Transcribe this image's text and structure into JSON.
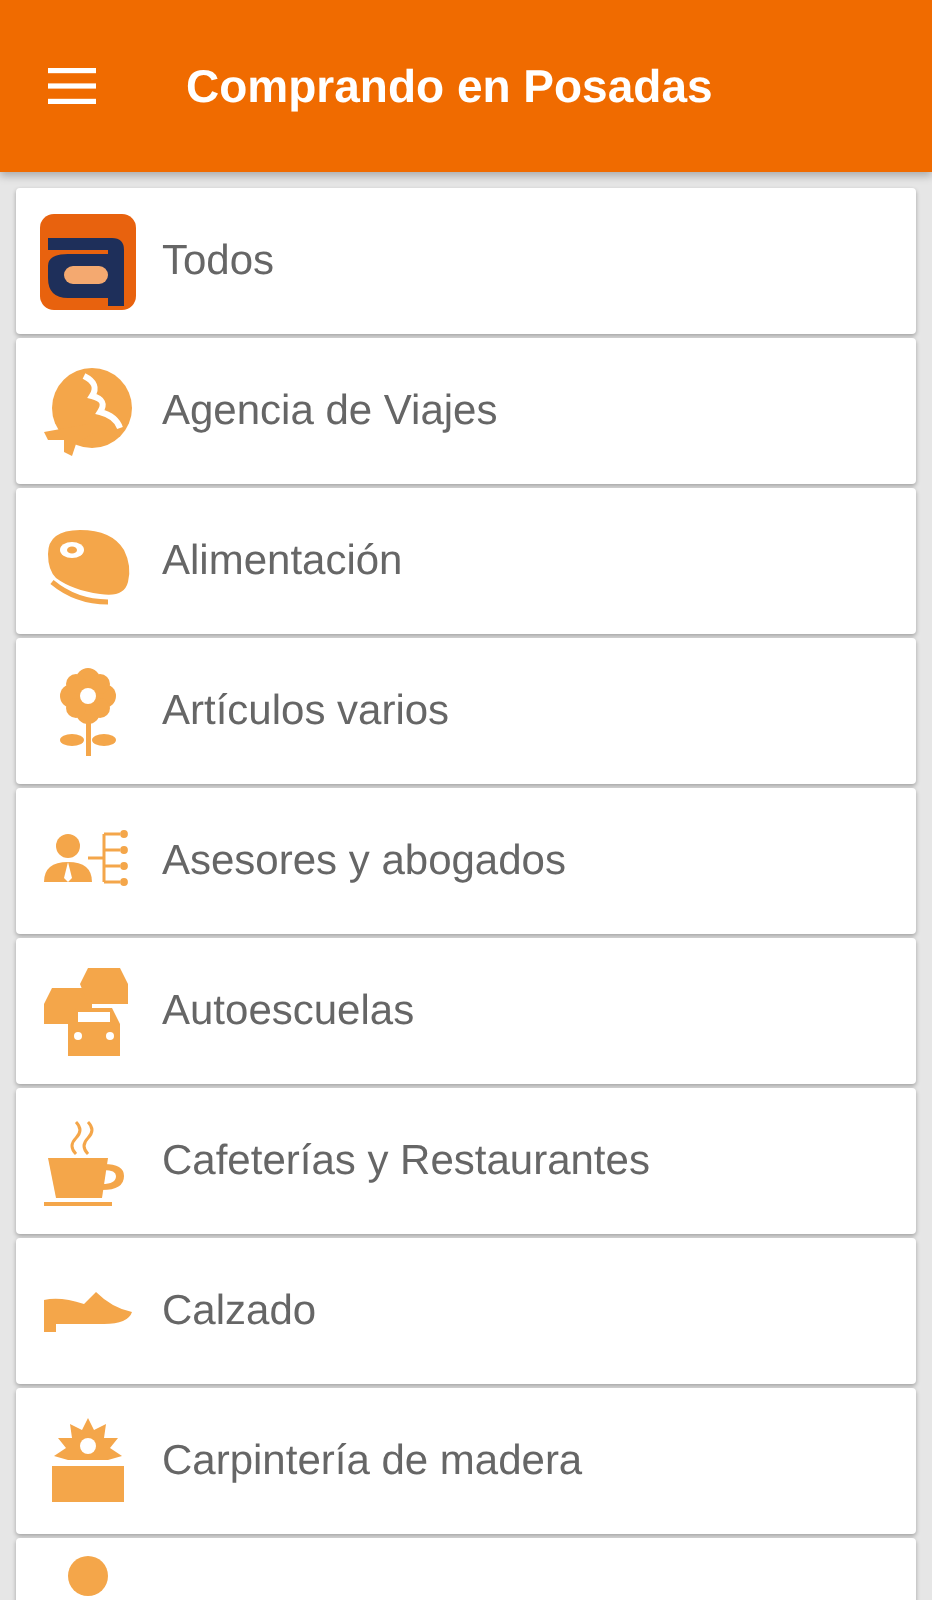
{
  "app_bar": {
    "title": "Comprando en Posadas"
  },
  "categories": [
    {
      "kind": "logo",
      "label": "Todos"
    },
    {
      "kind": "globe",
      "label": "Agencia de Viajes"
    },
    {
      "kind": "meat",
      "label": "Alimentación"
    },
    {
      "kind": "flower",
      "label": "Artículos varios"
    },
    {
      "kind": "advisor",
      "label": "Asesores y abogados"
    },
    {
      "kind": "cars",
      "label": "Autoescuelas"
    },
    {
      "kind": "cup",
      "label": "Cafeterías y Restaurantes"
    },
    {
      "kind": "shoe",
      "label": "Calzado"
    },
    {
      "kind": "saw",
      "label": "Carpintería de madera"
    },
    {
      "kind": "pin"
    }
  ]
}
